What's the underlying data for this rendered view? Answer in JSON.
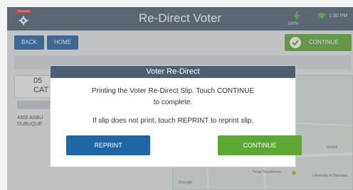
{
  "header": {
    "training_badge": "TRAINING",
    "title": "Re-Direct Voter",
    "battery": "100%",
    "time": "1:30 PM"
  },
  "nav": {
    "back": "BACK",
    "home": "HOME",
    "continue": "CONTINUE"
  },
  "background": {
    "card_number": "05",
    "card_sub": "CAT",
    "address_line1": "4300 ASBU",
    "address_line2": "DUBUQUE"
  },
  "map": {
    "labels": [
      "School",
      "Texas Roadhouse",
      "University of Dubuque"
    ],
    "provider": "Google"
  },
  "modal": {
    "title": "Voter Re-Direct",
    "message_line1": "Printing the Voter Re-Direct Slip. Touch CONTINUE",
    "message_line2": "to complete.",
    "message_line3": "If slip does not print, touch REPRINT to reprint slip.",
    "reprint": "REPRINT",
    "continue": "CONTINUE"
  },
  "colors": {
    "header_bg": "#4e5f72",
    "primary_blue": "#1b62a3",
    "success_green": "#5ba833",
    "training_red": "#d9302c"
  }
}
